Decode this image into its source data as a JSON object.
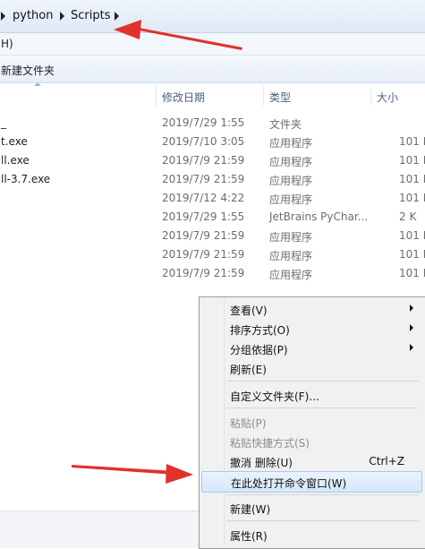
{
  "address": {
    "segments": [
      "python",
      "Scripts"
    ]
  },
  "menubar": {
    "label": "H)"
  },
  "toolbar": {
    "new_folder": "新建文件夹"
  },
  "columns": {
    "date": "修改日期",
    "type": "类型",
    "size": "大小"
  },
  "files": [
    {
      "name": "_",
      "date": "2019/7/29 1:55",
      "type": "文件夹",
      "size": ""
    },
    {
      "name": "t.exe",
      "date": "2019/7/10 3:05",
      "type": "应用程序",
      "size": "101 K"
    },
    {
      "name": "ll.exe",
      "date": "2019/7/9 21:59",
      "type": "应用程序",
      "size": "101 K"
    },
    {
      "name": "ll-3.7.exe",
      "date": "2019/7/9 21:59",
      "type": "应用程序",
      "size": "101 K"
    },
    {
      "name": "",
      "date": "2019/7/12 4:22",
      "type": "应用程序",
      "size": "101 K"
    },
    {
      "name": "",
      "date": "2019/7/29 1:55",
      "type": "JetBrains PyChar...",
      "size": "2 K"
    },
    {
      "name": "",
      "date": "2019/7/9 21:59",
      "type": "应用程序",
      "size": "101 K"
    },
    {
      "name": "",
      "date": "2019/7/9 21:59",
      "type": "应用程序",
      "size": "101 K"
    },
    {
      "name": "",
      "date": "2019/7/9 21:59",
      "type": "应用程序",
      "size": "101 K"
    }
  ],
  "context_menu": {
    "view": "查看(V)",
    "sort": "排序方式(O)",
    "group": "分组依据(P)",
    "refresh": "刷新(E)",
    "customize": "自定义文件夹(F)...",
    "paste": "粘贴(P)",
    "paste_shortcut": "粘贴快捷方式(S)",
    "undo": "撤消 删除(U)",
    "undo_shortcut": "Ctrl+Z",
    "open_cmd": "在此处打开命令窗口(W)",
    "new": "新建(W)",
    "properties": "属性(R)"
  },
  "colors": {
    "arrow": "#e0312b",
    "highlight": "#d6e7fb"
  }
}
